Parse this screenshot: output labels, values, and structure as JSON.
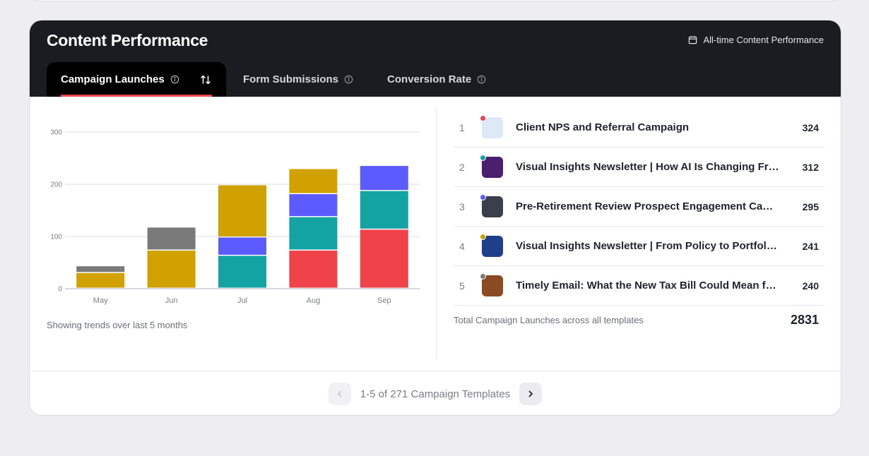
{
  "header": {
    "title": "Content Performance",
    "range_label": "All-time Content Performance"
  },
  "tabs": [
    {
      "label": "Campaign Launches",
      "active": true
    },
    {
      "label": "Form Submissions",
      "active": false
    },
    {
      "label": "Conversion Rate",
      "active": false
    }
  ],
  "chart_data": {
    "type": "bar",
    "stacked": true,
    "categories": [
      "May",
      "Jun",
      "Jul",
      "Aug",
      "Sep"
    ],
    "ylim": [
      0,
      300
    ],
    "yticks": [
      0,
      100,
      200,
      300
    ],
    "grid": true,
    "series": [
      {
        "color": "#ef4249",
        "values": [
          0,
          0,
          0,
          73,
          113
        ]
      },
      {
        "color": "#14a3a3",
        "values": [
          0,
          0,
          63,
          64,
          74
        ]
      },
      {
        "color": "#5b5bff",
        "values": [
          0,
          0,
          35,
          44,
          48
        ]
      },
      {
        "color": "#d1a100",
        "values": [
          30,
          73,
          100,
          48,
          0
        ]
      },
      {
        "color": "#7a7a7a",
        "values": [
          13,
          44,
          0,
          0,
          0
        ]
      }
    ],
    "caption": "Showing trends over last 5 months"
  },
  "list": [
    {
      "rank": "1",
      "name": "Client NPS and Referral Campaign",
      "count": "324",
      "dot": "#e5484d",
      "thumb": "#dfe8f7"
    },
    {
      "rank": "2",
      "name": "Visual Insights Newsletter | How AI Is Changing Fraud Prevention",
      "count": "312",
      "dot": "#14a3a3",
      "thumb": "#4a1f6e"
    },
    {
      "rank": "3",
      "name": "Pre-Retirement Review Prospect Engagement Campaign",
      "count": "295",
      "dot": "#5b5bff",
      "thumb": "#3a3f4a"
    },
    {
      "rank": "4",
      "name": "Visual Insights Newsletter | From Policy to Portfolio: What You Need to Know",
      "count": "241",
      "dot": "#d1a100",
      "thumb": "#1f3f8a"
    },
    {
      "rank": "5",
      "name": "Timely Email: What the New Tax Bill Could Mean for You",
      "count": "240",
      "dot": "#7a7a7a",
      "thumb": "#8a4a22"
    }
  ],
  "total": {
    "label": "Total Campaign Launches across all templates",
    "value": "2831"
  },
  "pager": {
    "text": "1-5 of 271 Campaign Templates"
  }
}
